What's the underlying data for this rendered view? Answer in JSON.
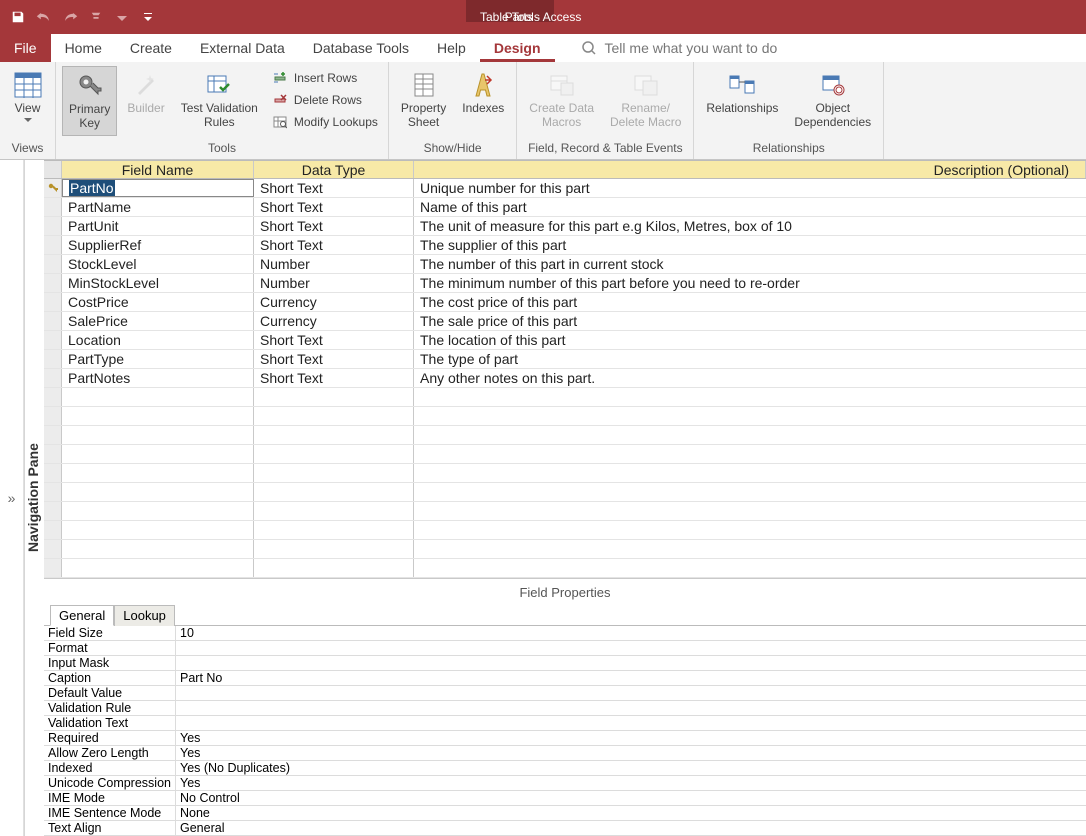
{
  "titlebar": {
    "tableTools": "Table Tools",
    "appTitle": "Parts  -  Access"
  },
  "tabs": {
    "file": "File",
    "home": "Home",
    "create": "Create",
    "external": "External Data",
    "db": "Database Tools",
    "help": "Help",
    "design": "Design",
    "tellme": "Tell me what you want to do"
  },
  "ribbon": {
    "views": {
      "label": "Views",
      "view": "View"
    },
    "tools": {
      "label": "Tools",
      "primaryKey": "Primary\nKey",
      "builder": "Builder",
      "testRules": "Test Validation\nRules",
      "insertRows": "Insert Rows",
      "deleteRows": "Delete Rows",
      "modifyLookups": "Modify Lookups"
    },
    "showHide": {
      "label": "Show/Hide",
      "propertySheet": "Property\nSheet",
      "indexes": "Indexes"
    },
    "frt": {
      "label": "Field, Record & Table Events",
      "createMacros": "Create Data\nMacros",
      "renameDelete": "Rename/\nDelete Macro"
    },
    "rel": {
      "label": "Relationships",
      "relationships": "Relationships",
      "objDeps": "Object\nDependencies"
    }
  },
  "nav": {
    "pane": "Navigation Pane"
  },
  "grid": {
    "headers": {
      "fieldName": "Field Name",
      "dataType": "Data Type",
      "description": "Description (Optional)"
    },
    "rows": [
      {
        "pk": true,
        "name": "PartNo",
        "type": "Short Text",
        "desc": "Unique number for this part"
      },
      {
        "name": "PartName",
        "type": "Short Text",
        "desc": "Name of this part"
      },
      {
        "name": "PartUnit",
        "type": "Short Text",
        "desc": "The unit of measure for this part e.g Kilos, Metres, box of 10"
      },
      {
        "name": "SupplierRef",
        "type": "Short Text",
        "desc": "The supplier of this part"
      },
      {
        "name": "StockLevel",
        "type": "Number",
        "desc": "The number of this part in current stock"
      },
      {
        "name": "MinStockLevel",
        "type": "Number",
        "desc": "The minimum number of this part before you need to re-order"
      },
      {
        "name": "CostPrice",
        "type": "Currency",
        "desc": "The cost price of this part"
      },
      {
        "name": "SalePrice",
        "type": "Currency",
        "desc": "The sale price of this part"
      },
      {
        "name": "Location",
        "type": "Short Text",
        "desc": "The location of this part"
      },
      {
        "name": "PartType",
        "type": "Short Text",
        "desc": "The type of part"
      },
      {
        "name": "PartNotes",
        "type": "Short Text",
        "desc": "Any other notes on this part."
      }
    ],
    "emptyRows": 10
  },
  "fieldProps": {
    "title": "Field Properties",
    "tabs": {
      "general": "General",
      "lookup": "Lookup"
    },
    "rows": [
      {
        "label": "Field Size",
        "value": "10"
      },
      {
        "label": "Format",
        "value": ""
      },
      {
        "label": "Input Mask",
        "value": ""
      },
      {
        "label": "Caption",
        "value": "Part No"
      },
      {
        "label": "Default Value",
        "value": ""
      },
      {
        "label": "Validation Rule",
        "value": ""
      },
      {
        "label": "Validation Text",
        "value": ""
      },
      {
        "label": "Required",
        "value": "Yes"
      },
      {
        "label": "Allow Zero Length",
        "value": "Yes"
      },
      {
        "label": "Indexed",
        "value": "Yes (No Duplicates)"
      },
      {
        "label": "Unicode Compression",
        "value": "Yes"
      },
      {
        "label": "IME Mode",
        "value": "No Control"
      },
      {
        "label": "IME Sentence Mode",
        "value": "None"
      },
      {
        "label": "Text Align",
        "value": "General"
      }
    ]
  }
}
